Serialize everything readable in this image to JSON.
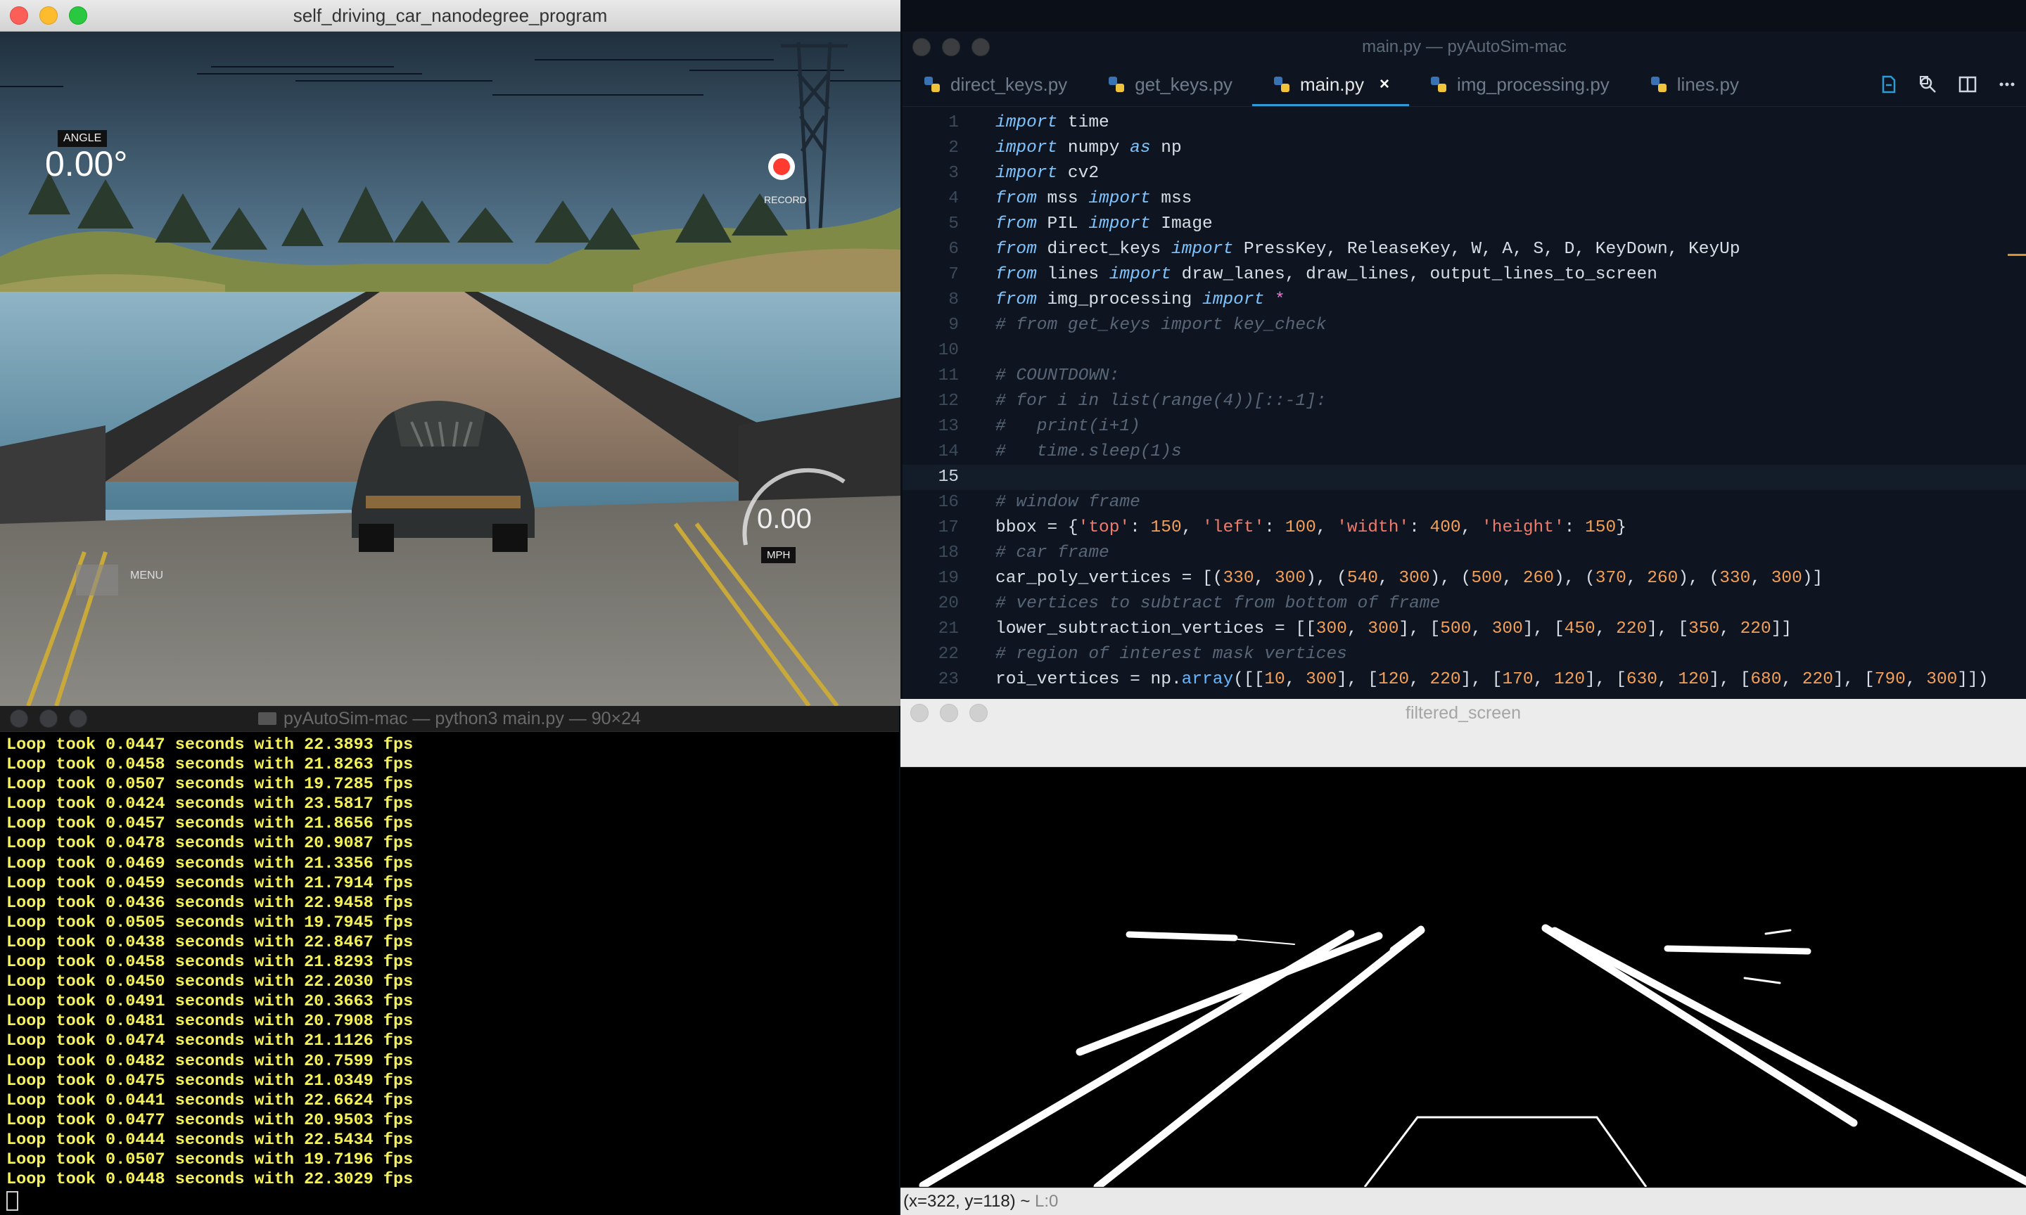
{
  "simulator": {
    "title": "self_driving_car_nanodegree_program",
    "angle_label": "ANGLE",
    "angle_value": "0.00°",
    "record_label": "RECORD",
    "menu_label": "MENU",
    "speed_value": "0.00",
    "speed_unit": "MPH"
  },
  "editor": {
    "title": "main.py — pyAutoSim-mac",
    "tabs": [
      {
        "label": "direct_keys.py"
      },
      {
        "label": "get_keys.py"
      },
      {
        "label": "main.py",
        "close": "×"
      },
      {
        "label": "img_processing.py"
      },
      {
        "label": "lines.py"
      }
    ],
    "current_line": 15,
    "lines": [
      {
        "n": "1",
        "t": "import time"
      },
      {
        "n": "2",
        "t": "import numpy as np"
      },
      {
        "n": "3",
        "t": "import cv2"
      },
      {
        "n": "4",
        "t": "from mss import mss"
      },
      {
        "n": "5",
        "t": "from PIL import Image"
      },
      {
        "n": "6",
        "t": "from direct_keys import PressKey, ReleaseKey, W, A, S, D, KeyDown, KeyUp"
      },
      {
        "n": "7",
        "t": "from lines import draw_lanes, draw_lines, output_lines_to_screen"
      },
      {
        "n": "8",
        "t": "from img_processing import *"
      },
      {
        "n": "9",
        "t": "# from get_keys import key_check"
      },
      {
        "n": "10",
        "t": ""
      },
      {
        "n": "11",
        "t": "# COUNTDOWN:"
      },
      {
        "n": "12",
        "t": "# for i in list(range(4))[::-1]:"
      },
      {
        "n": "13",
        "t": "#   print(i+1)"
      },
      {
        "n": "14",
        "t": "#   time.sleep(1)s"
      },
      {
        "n": "15",
        "t": ""
      },
      {
        "n": "16",
        "t": "# window frame"
      },
      {
        "n": "17",
        "t": "bbox = {'top': 150, 'left': 100, 'width': 400, 'height': 150}"
      },
      {
        "n": "18",
        "t": "# car frame"
      },
      {
        "n": "19",
        "t": "car_poly_vertices = [(330, 300), (540, 300), (500, 260), (370, 260), (330, 300)]"
      },
      {
        "n": "20",
        "t": "# vertices to subtract from bottom of frame"
      },
      {
        "n": "21",
        "t": "lower_subtraction_vertices = [[300, 300], [500, 300], [450, 220], [350, 220]]"
      },
      {
        "n": "22",
        "t": "# region of interest mask vertices"
      },
      {
        "n": "23",
        "t": "roi_vertices = np.array([[10, 300], [120, 220], [170, 120], [630, 120], [680, 220], [790, 300]])"
      }
    ]
  },
  "terminal": {
    "title": "pyAutoSim-mac — python3 main.py — 90×24",
    "lines": [
      "Loop took 0.0447 seconds with 22.3893 fps",
      "Loop took 0.0458 seconds with 21.8263 fps",
      "Loop took 0.0507 seconds with 19.7285 fps",
      "Loop took 0.0424 seconds with 23.5817 fps",
      "Loop took 0.0457 seconds with 21.8656 fps",
      "Loop took 0.0478 seconds with 20.9087 fps",
      "Loop took 0.0469 seconds with 21.3356 fps",
      "Loop took 0.0459 seconds with 21.7914 fps",
      "Loop took 0.0436 seconds with 22.9458 fps",
      "Loop took 0.0505 seconds with 19.7945 fps",
      "Loop took 0.0438 seconds with 22.8467 fps",
      "Loop took 0.0458 seconds with 21.8293 fps",
      "Loop took 0.0450 seconds with 22.2030 fps",
      "Loop took 0.0491 seconds with 20.3663 fps",
      "Loop took 0.0481 seconds with 20.7908 fps",
      "Loop took 0.0474 seconds with 21.1126 fps",
      "Loop took 0.0482 seconds with 20.7599 fps",
      "Loop took 0.0475 seconds with 21.0349 fps",
      "Loop took 0.0441 seconds with 22.6624 fps",
      "Loop took 0.0477 seconds with 20.9503 fps",
      "Loop took 0.0444 seconds with 22.5434 fps",
      "Loop took 0.0507 seconds with 19.7196 fps",
      "Loop took 0.0448 seconds with 22.3029 fps"
    ]
  },
  "filtered": {
    "title": "filtered_screen",
    "status_coords": "(x=322, y=118) ~",
    "status_level": "L:0"
  },
  "colors": {
    "terminal_text": "#f6f25a",
    "editor_bg": "#0e1520",
    "tab_underline": "#2f9ad6",
    "record_red": "#ff3b30"
  }
}
